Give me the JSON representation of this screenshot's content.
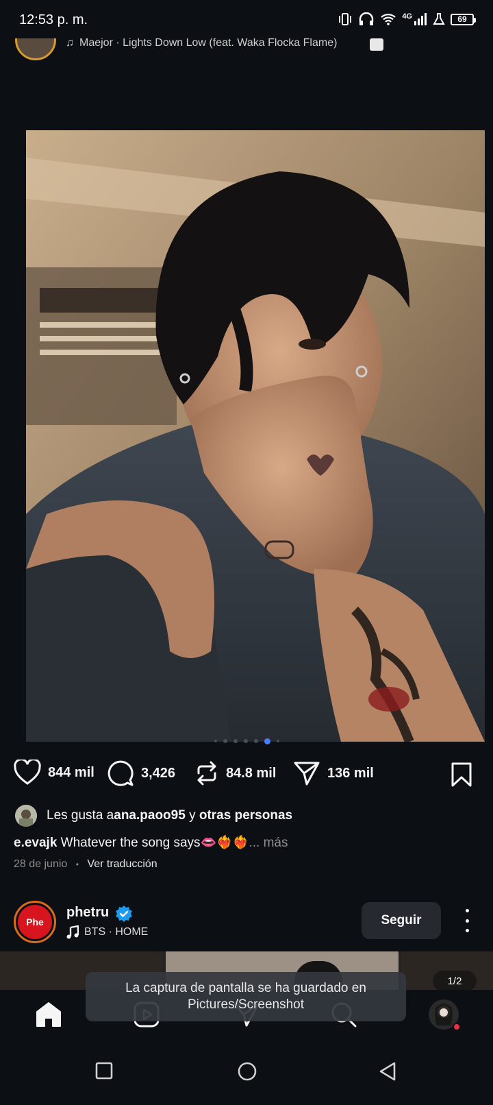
{
  "status_bar": {
    "time": "12:53 p. m.",
    "network": "4G",
    "battery": "69"
  },
  "previous_post": {
    "music": "Maejor · Lights Down Low (feat. Waka Flocka Flame)"
  },
  "post": {
    "carousel_dots": 7,
    "carousel_active_index": 5,
    "actions": {
      "likes": "844 mil",
      "comments": "3,426",
      "reposts": "84.8 mil",
      "shares": "136 mil"
    },
    "liked_by": {
      "prefix": "Les gusta a ",
      "user": "ana.paoo95",
      "connector": " y ",
      "others": "otras personas"
    },
    "caption": {
      "username": "e.evajk",
      "text": " Whatever the song says👄❤️‍🔥❤️‍🔥",
      "more": "... más"
    },
    "date": "28 de junio",
    "separator": "•",
    "translate": "Ver traducción"
  },
  "next_post": {
    "avatar_text": "Phe",
    "username": "phetru",
    "music": "BTS · HOME",
    "follow_label": "Seguir",
    "counter": "1/2"
  },
  "toast": {
    "message": "La captura de pantalla se ha guardado en Pictures/Screenshot"
  },
  "colors": {
    "background": "#0c1014",
    "accent": "#4a7cf7",
    "verified": "#1d9bf0"
  }
}
